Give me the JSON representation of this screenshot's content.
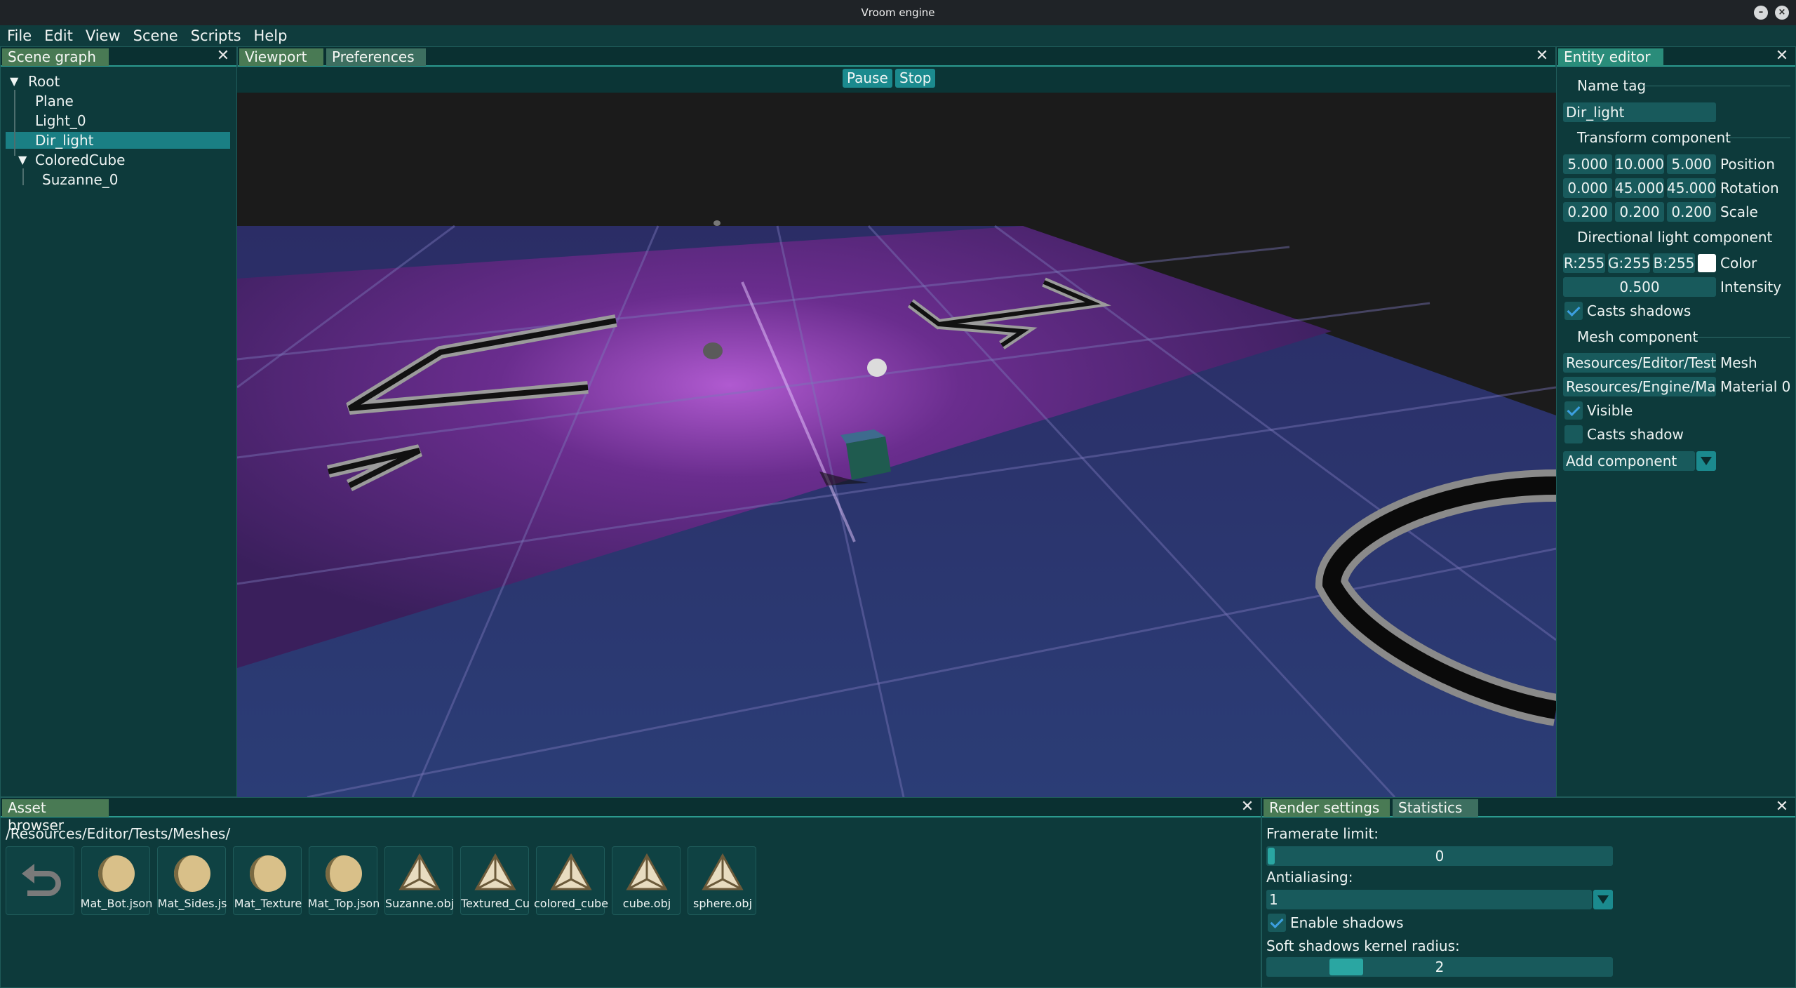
{
  "window": {
    "title": "Vroom engine"
  },
  "menu": [
    "File",
    "Edit",
    "View",
    "Scene",
    "Scripts",
    "Help"
  ],
  "scene_graph": {
    "tab": "Scene graph",
    "items": [
      {
        "label": "Root"
      },
      {
        "label": "Plane"
      },
      {
        "label": "Light_0"
      },
      {
        "label": "Dir_light",
        "selected": true
      },
      {
        "label": "ColoredCube"
      },
      {
        "label": "Suzanne_0"
      }
    ]
  },
  "viewport": {
    "tabs": [
      "Viewport",
      "Preferences"
    ],
    "pause_label": "Pause",
    "stop_label": "Stop"
  },
  "entity_editor": {
    "tab": "Entity editor",
    "name_tag_label": "Name tag",
    "name_tag_value": "Dir_light",
    "transform_label": "Transform component",
    "position": {
      "values": [
        "5.000",
        "10.000",
        "5.000"
      ],
      "label": "Position"
    },
    "rotation": {
      "values": [
        "0.000",
        "45.000",
        "45.000"
      ],
      "label": "Rotation"
    },
    "scale": {
      "values": [
        "0.200",
        "0.200",
        "0.200"
      ],
      "label": "Scale"
    },
    "dir_light_label": "Directional light component",
    "color": {
      "r": "R:255",
      "g": "G:255",
      "b": "B:255",
      "label": "Color",
      "swatch": "#ffffff"
    },
    "intensity": {
      "value": "0.500",
      "label": "Intensity"
    },
    "casts_shadows_label": "Casts shadows",
    "mesh_label": "Mesh component",
    "mesh": {
      "value": "Resources/Editor/Tests",
      "label": "Mesh"
    },
    "material": {
      "value": "Resources/Engine/Mate",
      "label": "Material 0"
    },
    "visible_label": "Visible",
    "casts_shadow_label": "Casts shadow",
    "add_component_label": "Add component"
  },
  "asset_browser": {
    "tab": "Asset browser",
    "path": "/Resources/Editor/Tests/Meshes/",
    "items": [
      {
        "label": "Mat_Bot.json",
        "icon": "material-icon"
      },
      {
        "label": "Mat_Sides.js",
        "icon": "material-icon"
      },
      {
        "label": "Mat_Texture",
        "icon": "material-icon"
      },
      {
        "label": "Mat_Top.json",
        "icon": "material-icon"
      },
      {
        "label": "Suzanne.obj",
        "icon": "mesh-icon"
      },
      {
        "label": "Textured_Cu",
        "icon": "mesh-icon"
      },
      {
        "label": "colored_cube",
        "icon": "mesh-icon"
      },
      {
        "label": "cube.obj",
        "icon": "mesh-icon"
      },
      {
        "label": "sphere.obj",
        "icon": "mesh-icon"
      }
    ]
  },
  "render_settings": {
    "tabs": [
      "Render settings",
      "Statistics"
    ],
    "framerate_label": "Framerate limit:",
    "framerate_value": "0",
    "antialiasing_label": "Antialiasing:",
    "antialiasing_value": "1",
    "enable_shadows_label": "Enable shadows",
    "soft_shadows_label": "Soft shadows kernel radius:",
    "soft_shadows_value": "2"
  }
}
